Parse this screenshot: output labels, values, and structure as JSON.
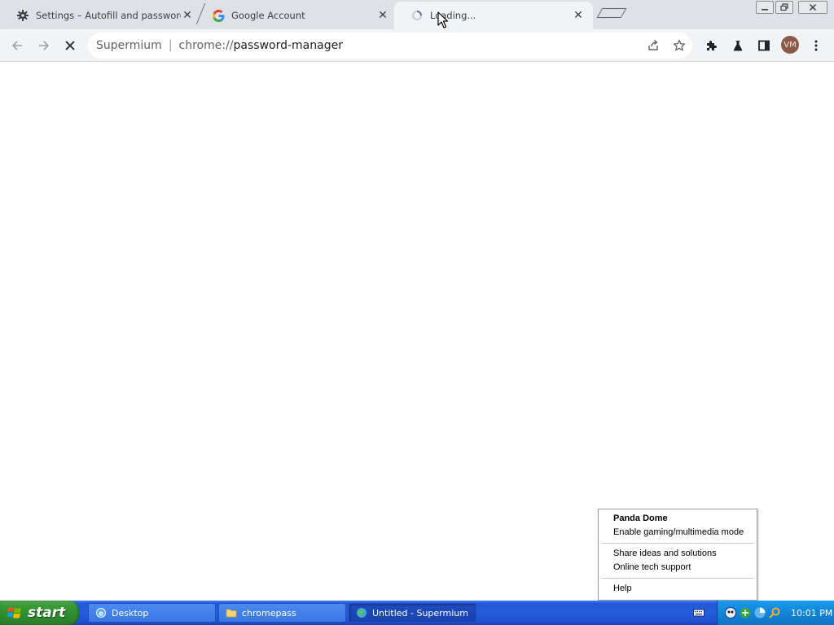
{
  "browser": {
    "tabs": [
      {
        "title": "Settings – Autofill and passwords",
        "icon": "gear-icon",
        "active": false
      },
      {
        "title": "Google Account",
        "icon": "google-g-icon",
        "active": false
      },
      {
        "title": "Loading...",
        "icon": "loading-spinner-icon",
        "active": true
      }
    ],
    "omnibox": {
      "site_label": "Supermium",
      "url_scheme": "chrome://",
      "url_path": "password-manager"
    },
    "profile": {
      "initials": "VM"
    }
  },
  "context_menu": {
    "items": [
      {
        "label": "Panda Dome",
        "bold": true
      },
      {
        "label": "Enable gaming/multimedia mode"
      },
      {
        "divider": true
      },
      {
        "label": "Share ideas and solutions"
      },
      {
        "label": "Online tech support"
      },
      {
        "divider": true
      },
      {
        "label": "Help"
      }
    ]
  },
  "taskbar": {
    "start_label": "start",
    "tasks": [
      {
        "label": "Desktop",
        "icon": "ie-icon",
        "active": false
      },
      {
        "label": "chromepass",
        "icon": "folder-icon",
        "active": false
      },
      {
        "label": "Untitled - Supermium",
        "icon": "supermium-icon",
        "active": true
      }
    ],
    "clock": "10:01 PM"
  },
  "colors": {
    "tabstrip_bg": "#dee1e6",
    "toolbar_bg": "#f1f3f4",
    "taskbar_blue": "#245edb",
    "start_green": "#3a9a3a",
    "avatar_bg": "#8b5a4a"
  }
}
